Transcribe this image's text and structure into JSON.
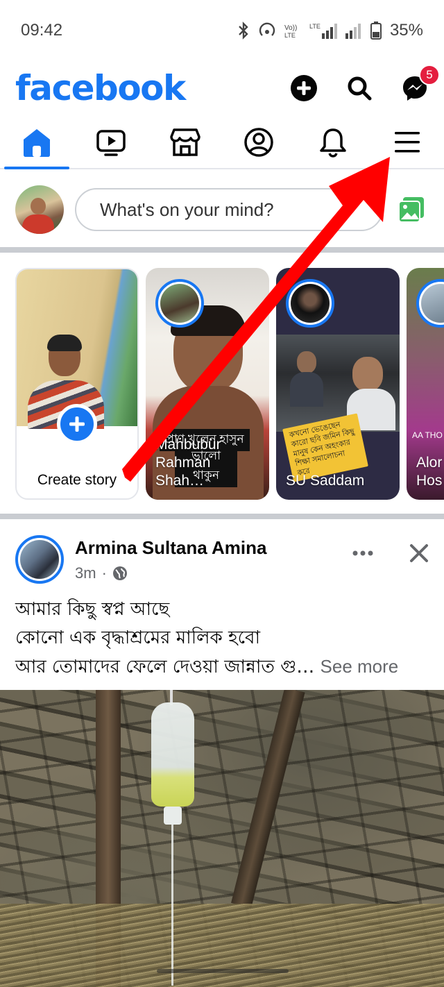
{
  "status_bar": {
    "time": "09:42",
    "battery_percent": "35%"
  },
  "header": {
    "brand": "facebook",
    "messenger_badge": "5"
  },
  "tabs": [
    {
      "name": "home",
      "active": true
    },
    {
      "name": "watch",
      "active": false
    },
    {
      "name": "marketplace",
      "active": false
    },
    {
      "name": "profile",
      "active": false
    },
    {
      "name": "notifications",
      "active": false
    },
    {
      "name": "menu",
      "active": false
    }
  ],
  "composer": {
    "placeholder": "What's on your mind?"
  },
  "stories": {
    "create_label": "Create story",
    "items": [
      {
        "name": "Mahbubur Rahman Shah…",
        "caption_line1": "প্রাণ খুলেন হাসুন",
        "caption_line2": "ভালো থাকুন"
      },
      {
        "name": "SU Saddam",
        "note": "কখনো ভেঙেছেন কারো ছবি জমিন কিছু মানুষ কেন অহংকার শিক্ষা সমালোচনা করে"
      },
      {
        "name": "Alor Hos",
        "overlay": "AA THO"
      }
    ]
  },
  "post": {
    "author": "Armina Sultana Amina",
    "time": "3m",
    "line1": "আমার কিছু স্বপ্ন আছে",
    "line2": "কোনো এক বৃদ্ধাশ্রমের মালিক হবো",
    "line3": "আর তোমাদের ফেলে দেওয়া জান্নাত গু…",
    "see_more": "See more"
  },
  "colors": {
    "brand_blue": "#1877f2",
    "badge_red": "#e41e3f",
    "annotation_arrow": "#ff0000"
  }
}
